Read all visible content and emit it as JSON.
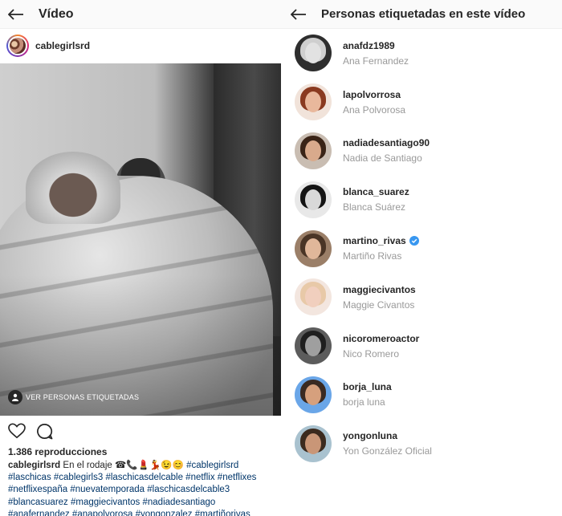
{
  "left": {
    "title": "Vídeo",
    "author": "cablegirlsrd",
    "tag_button_label": "VER PERSONAS ETIQUETADAS",
    "views": "1.386 reproducciones",
    "caption_user": "cablegirlsrd",
    "caption_text": "En el rodaje ☎📞💄💃😉😊",
    "caption_tags_1": "#cablegirlsrd",
    "caption_tags_2": "#laschicas #cablegirls3 #laschicasdelcable #netflix #netflixes",
    "caption_tags_3": "#netflixespaña #nuevatemporada #laschicasdelcable3",
    "caption_tags_4": "#blancasuarez #maggiecivantos #nadiadesantiago",
    "caption_tags_5": "#anafernandez #anapolvorosa #yongonzalez #martiñorivas"
  },
  "right": {
    "title": "Personas etiquetadas en este vídeo",
    "people": [
      {
        "username": "anafdz1989",
        "fullname": "Ana Fernandez",
        "verified": false
      },
      {
        "username": "lapolvorrosa",
        "fullname": "Ana Polvorosa",
        "verified": false
      },
      {
        "username": "nadiadesantiago90",
        "fullname": "Nadia de Santiago",
        "verified": false
      },
      {
        "username": "blanca_suarez",
        "fullname": "Blanca Suárez",
        "verified": false
      },
      {
        "username": "martino_rivas",
        "fullname": "Martiño Rivas",
        "verified": true
      },
      {
        "username": "maggiecivantos",
        "fullname": "Maggie Civantos",
        "verified": false
      },
      {
        "username": "nicoromeroactor",
        "fullname": "Nico Romero",
        "verified": false
      },
      {
        "username": "borja_luna",
        "fullname": "borja luna",
        "verified": false
      },
      {
        "username": "yongonluna",
        "fullname": "Yon González Oficial",
        "verified": false
      }
    ]
  },
  "colors": {
    "verified_badge": "#3897f0",
    "hashtag": "#003569",
    "secondary_text": "#999999",
    "primary_text": "#262626"
  },
  "icons": [
    "back-arrow-icon",
    "heart-icon",
    "comment-icon",
    "person-tag-icon",
    "verified-badge-icon"
  ]
}
